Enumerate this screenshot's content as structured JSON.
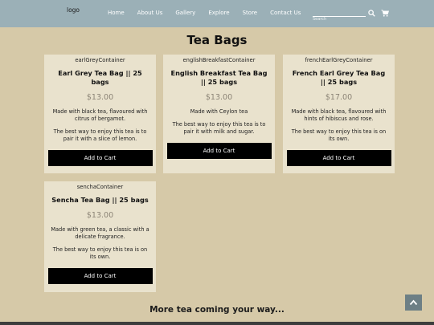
{
  "header": {
    "logo": "logo",
    "nav": [
      "Home",
      "About Us",
      "Gallery",
      "Explore",
      "Store",
      "Contact Us"
    ],
    "search_placeholder": "Search"
  },
  "page_title": "Tea Bags",
  "cards": [
    {
      "id": "earlGreyContainer",
      "name": "Earl Grey Tea Bag || 25 bags",
      "price": "$13.00",
      "desc": "Made with black tea, flavoured with citrus of bergamot.",
      "tip": "The best way to enjoy this tea is to pair it with a slice of lemon.",
      "button": "Add to Cart"
    },
    {
      "id": "englishBreakfastContainer",
      "name": "English Breakfast Tea Bag || 25 bags",
      "price": "$13.00",
      "desc": "Made with Ceylon tea",
      "tip": "The best way to enjoy this tea is to pair it with milk and sugar.",
      "button": "Add to Cart"
    },
    {
      "id": "frenchEarlGreyContainer",
      "name": "French Earl Grey Tea Bag || 25 bags",
      "price": "$17.00",
      "desc": "Made with black tea, flavoured with hints of hibiscus and rose.",
      "tip": "The best way to enjoy this tea is on its own.",
      "button": "Add to Cart"
    },
    {
      "id": "senchaContainer",
      "name": "Sencha Tea Bag || 25 bags",
      "price": "$13.00",
      "desc": "Made with green tea, a classic with a delicate fragrance.",
      "tip": "The best way to enjoy this tea is on its own.",
      "button": "Add to Cart"
    }
  ],
  "footer_text": "More tea coming your way...",
  "icons": {
    "search": "search-icon",
    "cart": "cart-icon",
    "scroll_top": "chevron-up-icon"
  },
  "colors": {
    "nav_bg": "#9bb0b7",
    "page_bg": "#d6c9a8",
    "card_bg": "#e9e2cd",
    "button_bg": "#000000"
  }
}
